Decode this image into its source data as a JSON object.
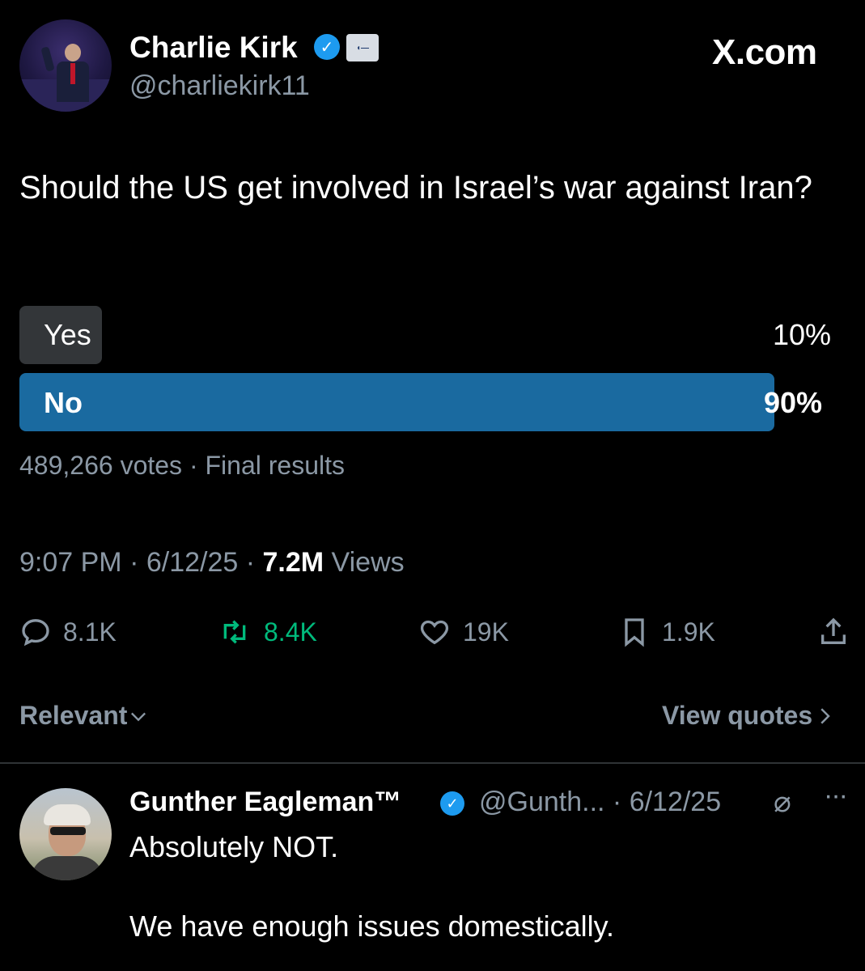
{
  "post": {
    "author_name": "Charlie Kirk",
    "author_handle": "@charliekirk11",
    "site_label": "X.com",
    "text": "Should the US get involved in Israel’s war against Iran?",
    "poll": {
      "options": [
        {
          "label": "Yes",
          "percent_text": "10%",
          "percent": 10
        },
        {
          "label": "No",
          "percent_text": "90%",
          "percent": 90
        }
      ],
      "summary": "489,266 votes · Final results"
    },
    "time": "9:07 PM · 6/12/25 · ",
    "views_count": "7.2M",
    "views_label": " Views",
    "actions": {
      "replies": "8.1K",
      "reposts": "8.4K",
      "likes": "19K",
      "bookmarks": "1.9K"
    },
    "repost_color": "#00ba7c",
    "poll_winner_color": "#1a6aa0",
    "verified_color": "#1d9bf0"
  },
  "replies_bar": {
    "sort_label": "Relevant",
    "quotes_label": "View quotes"
  },
  "reply": {
    "author_name": "Gunther Eagleman™",
    "handle_date": "@Gunth... · 6/12/25",
    "line1": "Absolutely NOT.",
    "line2": "We have enough issues domestically."
  },
  "icons": [
    "reply-icon",
    "repost-icon",
    "like-icon",
    "bookmark-icon",
    "share-icon",
    "chevron-down-icon",
    "chevron-right-icon",
    "verified-badge-icon",
    "more-icon"
  ]
}
